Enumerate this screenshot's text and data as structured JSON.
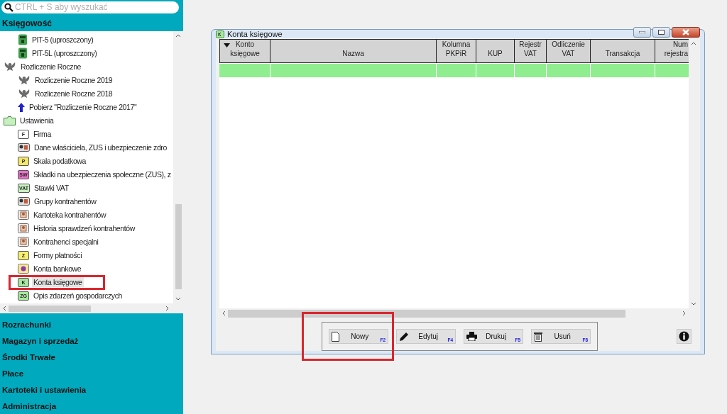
{
  "sidebar": {
    "search": {
      "placeholder": "CTRL + S aby wyszukać"
    },
    "section": {
      "label": "Księgowość"
    },
    "tree": [
      {
        "children": [
          {
            "label": "PIT-5 (uproszczony)",
            "icon": {
              "kind": "pit"
            },
            "selected": false
          },
          {
            "label": "PIT-5L (uproszczony)",
            "icon": {
              "kind": "pit"
            },
            "selected": false
          }
        ]
      },
      {
        "label": "Rozliczenie Roczne",
        "icon": {
          "kind": "eagle"
        },
        "selected": false,
        "children": [
          {
            "label": "Rozliczenie Roczne 2019",
            "icon": {
              "kind": "eagle"
            },
            "selected": false
          },
          {
            "label": "Rozliczenie Roczne 2018",
            "icon": {
              "kind": "eagle"
            },
            "selected": false
          },
          {
            "label": "Pobierz \"Rozliczenie Roczne 2017\"",
            "icon": {
              "kind": "arrow"
            },
            "selected": false
          }
        ]
      },
      {
        "label": "Ustawienia",
        "icon": {
          "kind": "folder"
        },
        "selected": false,
        "children": [
          {
            "label": "Firma",
            "icon": {
              "kind": "badge",
              "text": "F",
              "color": "#ffffff"
            },
            "selected": false
          },
          {
            "label": "Dane właściciela, ZUS i ubezpieczenie zdro",
            "icon": {
              "kind": "group"
            },
            "selected": false
          },
          {
            "label": "Skala podatkowa",
            "icon": {
              "kind": "badge",
              "text": "P",
              "color": "#f4e76a"
            },
            "selected": false
          },
          {
            "label": "Składki na ubezpieczenia społeczne (ZUS), z",
            "icon": {
              "kind": "badge",
              "text": "SW",
              "color": "#e874c8"
            },
            "selected": false
          },
          {
            "label": "Stawki VAT",
            "icon": {
              "kind": "badge",
              "text": "VAT",
              "color": "#c8f0c0"
            },
            "selected": false
          },
          {
            "label": "Grupy kontrahentów",
            "icon": {
              "kind": "group"
            },
            "selected": false
          },
          {
            "label": "Kartoteka kontrahentów",
            "icon": {
              "kind": "person"
            },
            "selected": false
          },
          {
            "label": "Historia sprawdzeń kontrahentów",
            "icon": {
              "kind": "person"
            },
            "selected": false
          },
          {
            "label": "Kontrahenci specjalni",
            "icon": {
              "kind": "person"
            },
            "selected": false
          },
          {
            "label": "Formy płatności",
            "icon": {
              "kind": "badge",
              "text": "Z",
              "color": "#f8f070"
            },
            "selected": false
          },
          {
            "label": "Konta bankowe",
            "icon": {
              "kind": "coin"
            },
            "selected": false
          },
          {
            "label": "Konta księgowe",
            "icon": {
              "kind": "badge",
              "text": "K",
              "color": "#a8e8a0"
            },
            "selected": true
          },
          {
            "label": "Opis zdarzeń gospodarczych",
            "icon": {
              "kind": "badge",
              "text": "ZG",
              "color": "#a8e8a0"
            },
            "selected": false
          }
        ]
      }
    ],
    "modules": [
      {
        "label": "Rozrachunki"
      },
      {
        "label": "Magazyn i sprzedaż"
      },
      {
        "label": "Środki Trwałe"
      },
      {
        "label": "Płace"
      },
      {
        "label": "Kartoteki i ustawienia"
      },
      {
        "label": "Administracja"
      }
    ]
  },
  "window": {
    "title": "Konta księgowe",
    "table": {
      "columns": [
        {
          "label": "Konto księgowe",
          "sorted": true
        },
        {
          "label": "Nazwa",
          "sorted": false
        },
        {
          "label": "Kolumna PKPiR",
          "sorted": false
        },
        {
          "label": "KUP",
          "sorted": false
        },
        {
          "label": "Rejestr VAT",
          "sorted": false
        },
        {
          "label": "Odliczenie VAT",
          "sorted": false
        },
        {
          "label": "Transakcja",
          "sorted": false
        },
        {
          "label": "Num rejestra",
          "sorted": false
        }
      ],
      "rows": [
        {
          "selected": true
        }
      ]
    },
    "buttons": [
      {
        "label": "Nowy",
        "key": "F2",
        "kind": "new"
      },
      {
        "label": "Edytuj",
        "key": "F4",
        "kind": "edit"
      },
      {
        "label": "Drukuj",
        "key": "F5",
        "kind": "print"
      },
      {
        "label": "Usuń",
        "key": "F8",
        "kind": "delete"
      }
    ]
  }
}
